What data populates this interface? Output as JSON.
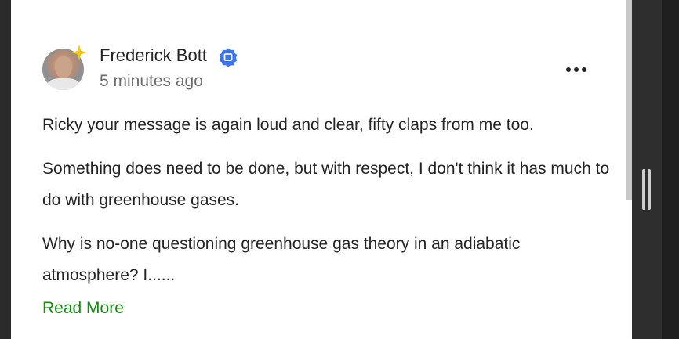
{
  "comment": {
    "author": "Frederick Bott",
    "timestamp": "5 minutes ago",
    "paragraphs": [
      "Ricky your message is again loud and clear, fifty claps from me too.",
      "Something does need to be done, but with respect, I don't think it has much to do with greenhouse gases.",
      "Why is no-one questioning greenhouse gas theory in an adiabatic atmosphere? I......"
    ],
    "read_more_label": "Read More"
  },
  "icons": {
    "star": "sparkle-star-icon",
    "badge": "verified-badge-icon",
    "more": "more-options-icon"
  },
  "colors": {
    "accent_green": "#1a8917",
    "badge_blue": "#3b73f0",
    "star_yellow": "#f5c518",
    "text_primary": "#242424",
    "text_secondary": "#6b6b6b"
  }
}
